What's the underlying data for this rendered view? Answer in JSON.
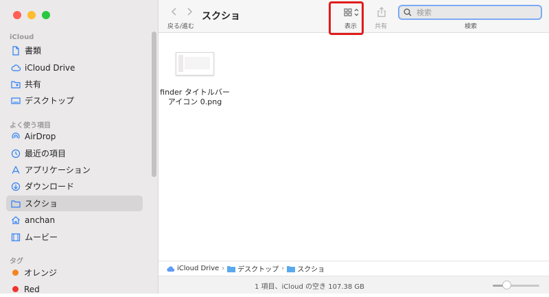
{
  "window": {
    "title": "スクショ",
    "nav_label": "戻る/進む",
    "back_icon": "chevron-left-icon",
    "forward_icon": "chevron-right-icon"
  },
  "toolbar": {
    "view_label": "表示",
    "share_label": "共有",
    "search_label": "検索",
    "search_placeholder": "検索",
    "highlight_color": "#e11b1b"
  },
  "sidebar": {
    "sections": [
      {
        "title": "iCloud",
        "items": [
          {
            "label": "書類",
            "icon": "document-icon"
          },
          {
            "label": "iCloud Drive",
            "icon": "cloud-icon"
          },
          {
            "label": "共有",
            "icon": "shared-folder-icon"
          },
          {
            "label": "デスクトップ",
            "icon": "desktop-icon"
          }
        ]
      },
      {
        "title": "よく使う項目",
        "items": [
          {
            "label": "AirDrop",
            "icon": "airdrop-icon"
          },
          {
            "label": "最近の項目",
            "icon": "clock-icon"
          },
          {
            "label": "アプリケーション",
            "icon": "applications-icon"
          },
          {
            "label": "ダウンロード",
            "icon": "download-icon"
          },
          {
            "label": "スクショ",
            "icon": "folder-icon",
            "selected": true
          },
          {
            "label": "anchan",
            "icon": "home-icon"
          },
          {
            "label": "ムービー",
            "icon": "film-icon"
          }
        ]
      },
      {
        "title": "タグ",
        "items": [
          {
            "label": "オレンジ",
            "color": "#f5831f"
          },
          {
            "label": "Red",
            "color": "#f0322f"
          }
        ]
      }
    ]
  },
  "content": {
    "files": [
      {
        "name_line1": "finder タイトルバー",
        "name_line2": "アイコン 0.png"
      }
    ]
  },
  "pathbar": {
    "segments": [
      "iCloud Drive",
      "デスクトップ",
      "スクショ"
    ],
    "separator": "›"
  },
  "statusbar": {
    "text": "1 項目、iCloud の空き 107.38 GB",
    "zoom_level": 0.3
  },
  "accent_color": "#2d7ff6"
}
